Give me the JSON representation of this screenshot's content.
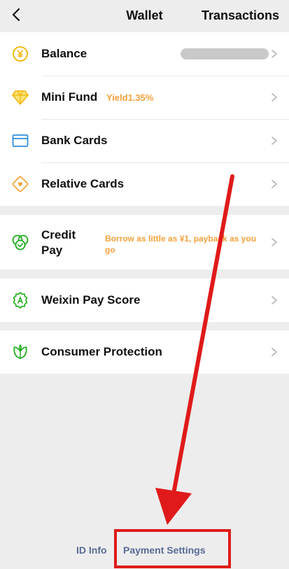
{
  "header": {
    "title": "Wallet",
    "action": "Transactions"
  },
  "rows": {
    "balance": {
      "label": "Balance"
    },
    "mini_fund": {
      "label": "Mini Fund",
      "yield": "Yield1.35%"
    },
    "bank_cards": {
      "label": "Bank Cards"
    },
    "relative_cards": {
      "label": "Relative Cards"
    },
    "credit_pay": {
      "label": "Credit Pay",
      "note": "Borrow as little as ¥1, payback as you go"
    },
    "pay_score": {
      "label": "Weixin Pay Score"
    },
    "consumer_protection": {
      "label": "Consumer Protection"
    }
  },
  "bottom_links": {
    "id_info": "ID Info",
    "payment_settings": "Payment Settings"
  },
  "icons": {
    "back": "chevron-left-icon",
    "balance": "yuan-coin-icon",
    "mini_fund": "diamond-icon",
    "bank_cards": "card-icon",
    "relative_cards": "heart-card-icon",
    "credit_pay": "credit-pay-icon",
    "pay_score": "gear-badge-icon",
    "consumer_protection": "leaf-shield-icon",
    "chevron": "chevron-right-icon"
  },
  "colors": {
    "accent_green": "#1aad19",
    "accent_orange": "#f3a23b",
    "link_blue": "#576b95",
    "annotation_red": "#e01a1a"
  }
}
